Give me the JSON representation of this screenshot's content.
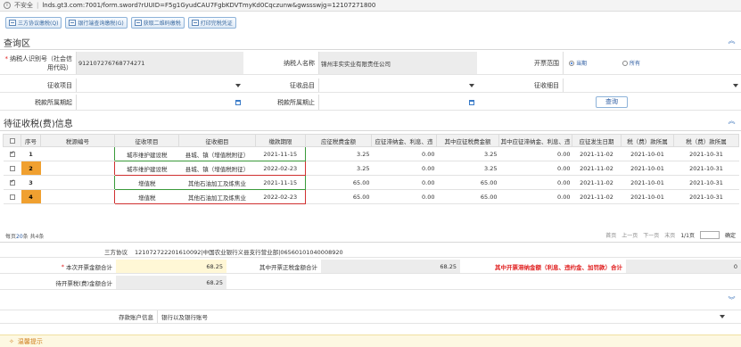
{
  "browser": {
    "security_label": "不安全",
    "url": "lnds.gt3.com:7001/form.sword?rUUID=F5g1GyudCAU7FgbKDVTmyKd0Cqczunw&gwssswjg=12107271800"
  },
  "toolbar": {
    "buttons": [
      "三方协议缴税(Q)",
      "银行端查询缴税(G)",
      "获取二维码缴税",
      "打印完税凭证"
    ]
  },
  "query": {
    "section_title": "查询区",
    "taxpayer_id_label": "纳税人识别号（社会信用代码）",
    "taxpayer_id_value": "91210727676877427­1",
    "taxpayer_name_label": "纳税人名称",
    "taxpayer_name_value": "锦州丰实实业有限责任公司",
    "billing_scope_label": "开票范围",
    "billing_scope_options": [
      "当期",
      "所有"
    ],
    "collect_item_label": "征收项目",
    "collect_category_label": "征收品目",
    "collect_subitem_label": "征收细目",
    "period_start_label": "税款所属期起",
    "period_end_label": "税款所属期止",
    "query_button": "查询"
  },
  "pending": {
    "section_title": "待征收税(费)信息",
    "columns": [
      "序号",
      "税源编号",
      "征收项目",
      "征收细目",
      "缴款期限",
      "应征税费金额",
      "应征滞纳金、利息、违",
      "其中应征税费金额",
      "其中应征滞纳金、利息、违",
      "应征发生日期",
      "税（费）款所属",
      "税（费）款所属"
    ],
    "rows": [
      {
        "checked": true,
        "seq": "1",
        "source": "",
        "item": "城市维护建设税",
        "subitem": "县城、镇（增值税附征）",
        "deadline": "2021-11-15",
        "tax": "3.25",
        "late": "0.00",
        "tax_in": "3.25",
        "late_in": "0.00",
        "occur": "2021-11-02",
        "from": "2021-10-01",
        "to": "2021-10-31"
      },
      {
        "checked": false,
        "seq": "2",
        "source": "",
        "item": "城市维护建设税",
        "subitem": "县城、镇（增值税附征）",
        "deadline": "2022-02-23",
        "tax": "3.25",
        "late": "0.00",
        "tax_in": "3.25",
        "late_in": "0.00",
        "occur": "2021-11-02",
        "from": "2021-10-01",
        "to": "2021-10-31"
      },
      {
        "checked": true,
        "seq": "3",
        "source": "",
        "item": "增值税",
        "subitem": "其他石油加工及炼焦业",
        "deadline": "2021-11-15",
        "tax": "65.00",
        "late": "0.00",
        "tax_in": "65.00",
        "late_in": "0.00",
        "occur": "2021-11-02",
        "from": "2021-10-01",
        "to": "2021-10-31"
      },
      {
        "checked": false,
        "seq": "4",
        "source": "",
        "item": "增值税",
        "subitem": "其他石油加工及炼焦业",
        "deadline": "2022-02-23",
        "tax": "65.00",
        "late": "0.00",
        "tax_in": "65.00",
        "late_in": "0.00",
        "occur": "2021-11-02",
        "from": "2021-10-01",
        "to": "2021-10-31"
      }
    ],
    "pager_prefix": "每页",
    "pager_size": "20",
    "pager_suffix": "条 共4条",
    "nav": [
      "首页",
      "上一页",
      "下一页",
      "末页",
      "1/1页"
    ],
    "go_label": "确定"
  },
  "summary": {
    "agreement_label": "三方协议",
    "agreement_value": "121072722201610092|中国农业银行义县支行营业部|06560101040008920",
    "invoice_total_label": "本次开票金额合计",
    "invoice_total_value": "68.25",
    "tax_total_label": "其中开票正税金额合计",
    "tax_total_value": "68.25",
    "late_total_label": "其中开票滞纳金额（利息、违约金、加罚款）合计",
    "late_total_value": "0",
    "pending_total_label": "待开票税(费)金额合计",
    "pending_total_value": "68.25",
    "account_label": "存款账户信息",
    "account_value": "银行以及银行账号"
  },
  "notice": {
    "title": "温馨提示"
  }
}
